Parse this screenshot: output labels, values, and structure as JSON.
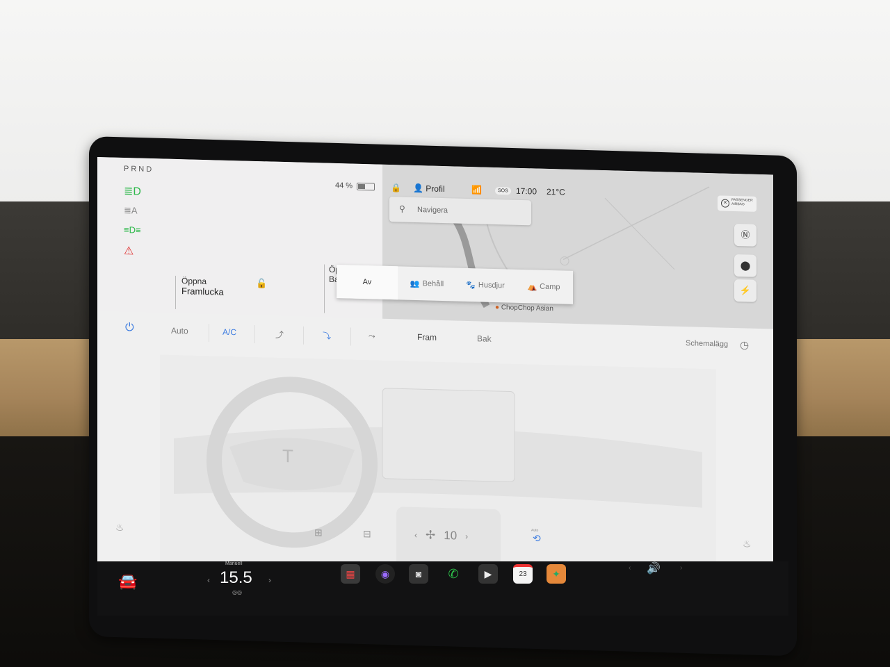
{
  "drive": {
    "gears": "PRND"
  },
  "battery": {
    "percent": "44 %",
    "fill": 0.44
  },
  "telltales": [
    {
      "icon": "headlight-on-icon",
      "glyph": "≣D",
      "color": "#2db84a"
    },
    {
      "icon": "auto-headlight-icon",
      "glyph": "≣A",
      "color": "#888888"
    },
    {
      "icon": "parking-light-icon",
      "glyph": "≡D≡",
      "color": "#2db84a"
    },
    {
      "icon": "seatbelt-warning-icon",
      "glyph": "⚠",
      "color": "#e03030"
    }
  ],
  "doors": {
    "front_label": "Öppna",
    "front_name": "Framlucka",
    "back_label": "Öppna",
    "back_name": "Ba"
  },
  "status": {
    "profile": "Profil",
    "sos": "SOS",
    "time": "17:00",
    "temp": "21°C",
    "airbag": "PASSENGER AIRBAG"
  },
  "map": {
    "search_placeholder": "Navigera",
    "poi": "ChopChop Asian"
  },
  "climate_popup": {
    "options": [
      {
        "label": "Av",
        "icon": "off",
        "selected": true
      },
      {
        "label": "Behåll",
        "icon": "keep-icon",
        "selected": false
      },
      {
        "label": "Husdjur",
        "icon": "pet-icon",
        "selected": false
      },
      {
        "label": "Camp",
        "icon": "camp-icon",
        "selected": false
      }
    ]
  },
  "climate": {
    "auto": "Auto",
    "ac": "A/C",
    "front": "Fram",
    "back": "Bak",
    "schedule": "Schemalägg",
    "fan_speed": "10",
    "recirc_auto": "Auto",
    "accent": "#3b7be0"
  },
  "bottom": {
    "mode": "Manuell",
    "temp": "15.5",
    "calendar_day": "23"
  }
}
